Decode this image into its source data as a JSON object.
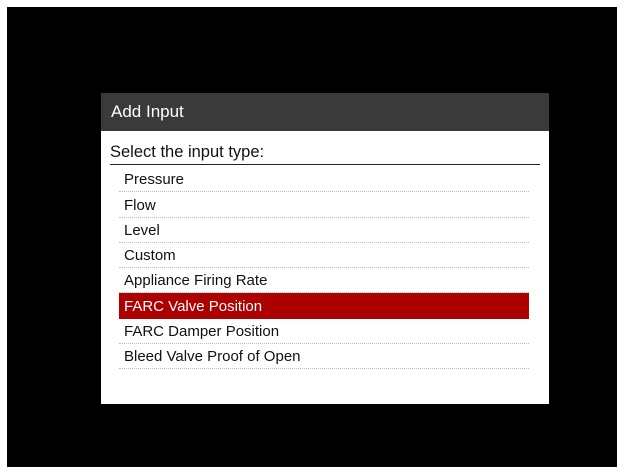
{
  "dialog": {
    "title": "Add Input",
    "prompt": "Select the input type:",
    "options": [
      "Pressure",
      "Flow",
      "Level",
      "Custom",
      "Appliance Firing Rate",
      "FARC Valve Position",
      "FARC Damper Position",
      "Bleed Valve Proof of Open"
    ],
    "selected_option": "FARC Valve Position"
  },
  "colors": {
    "screen_background": "#000000",
    "titlebar": "#3a3a3a",
    "selection": "#ad0000"
  }
}
